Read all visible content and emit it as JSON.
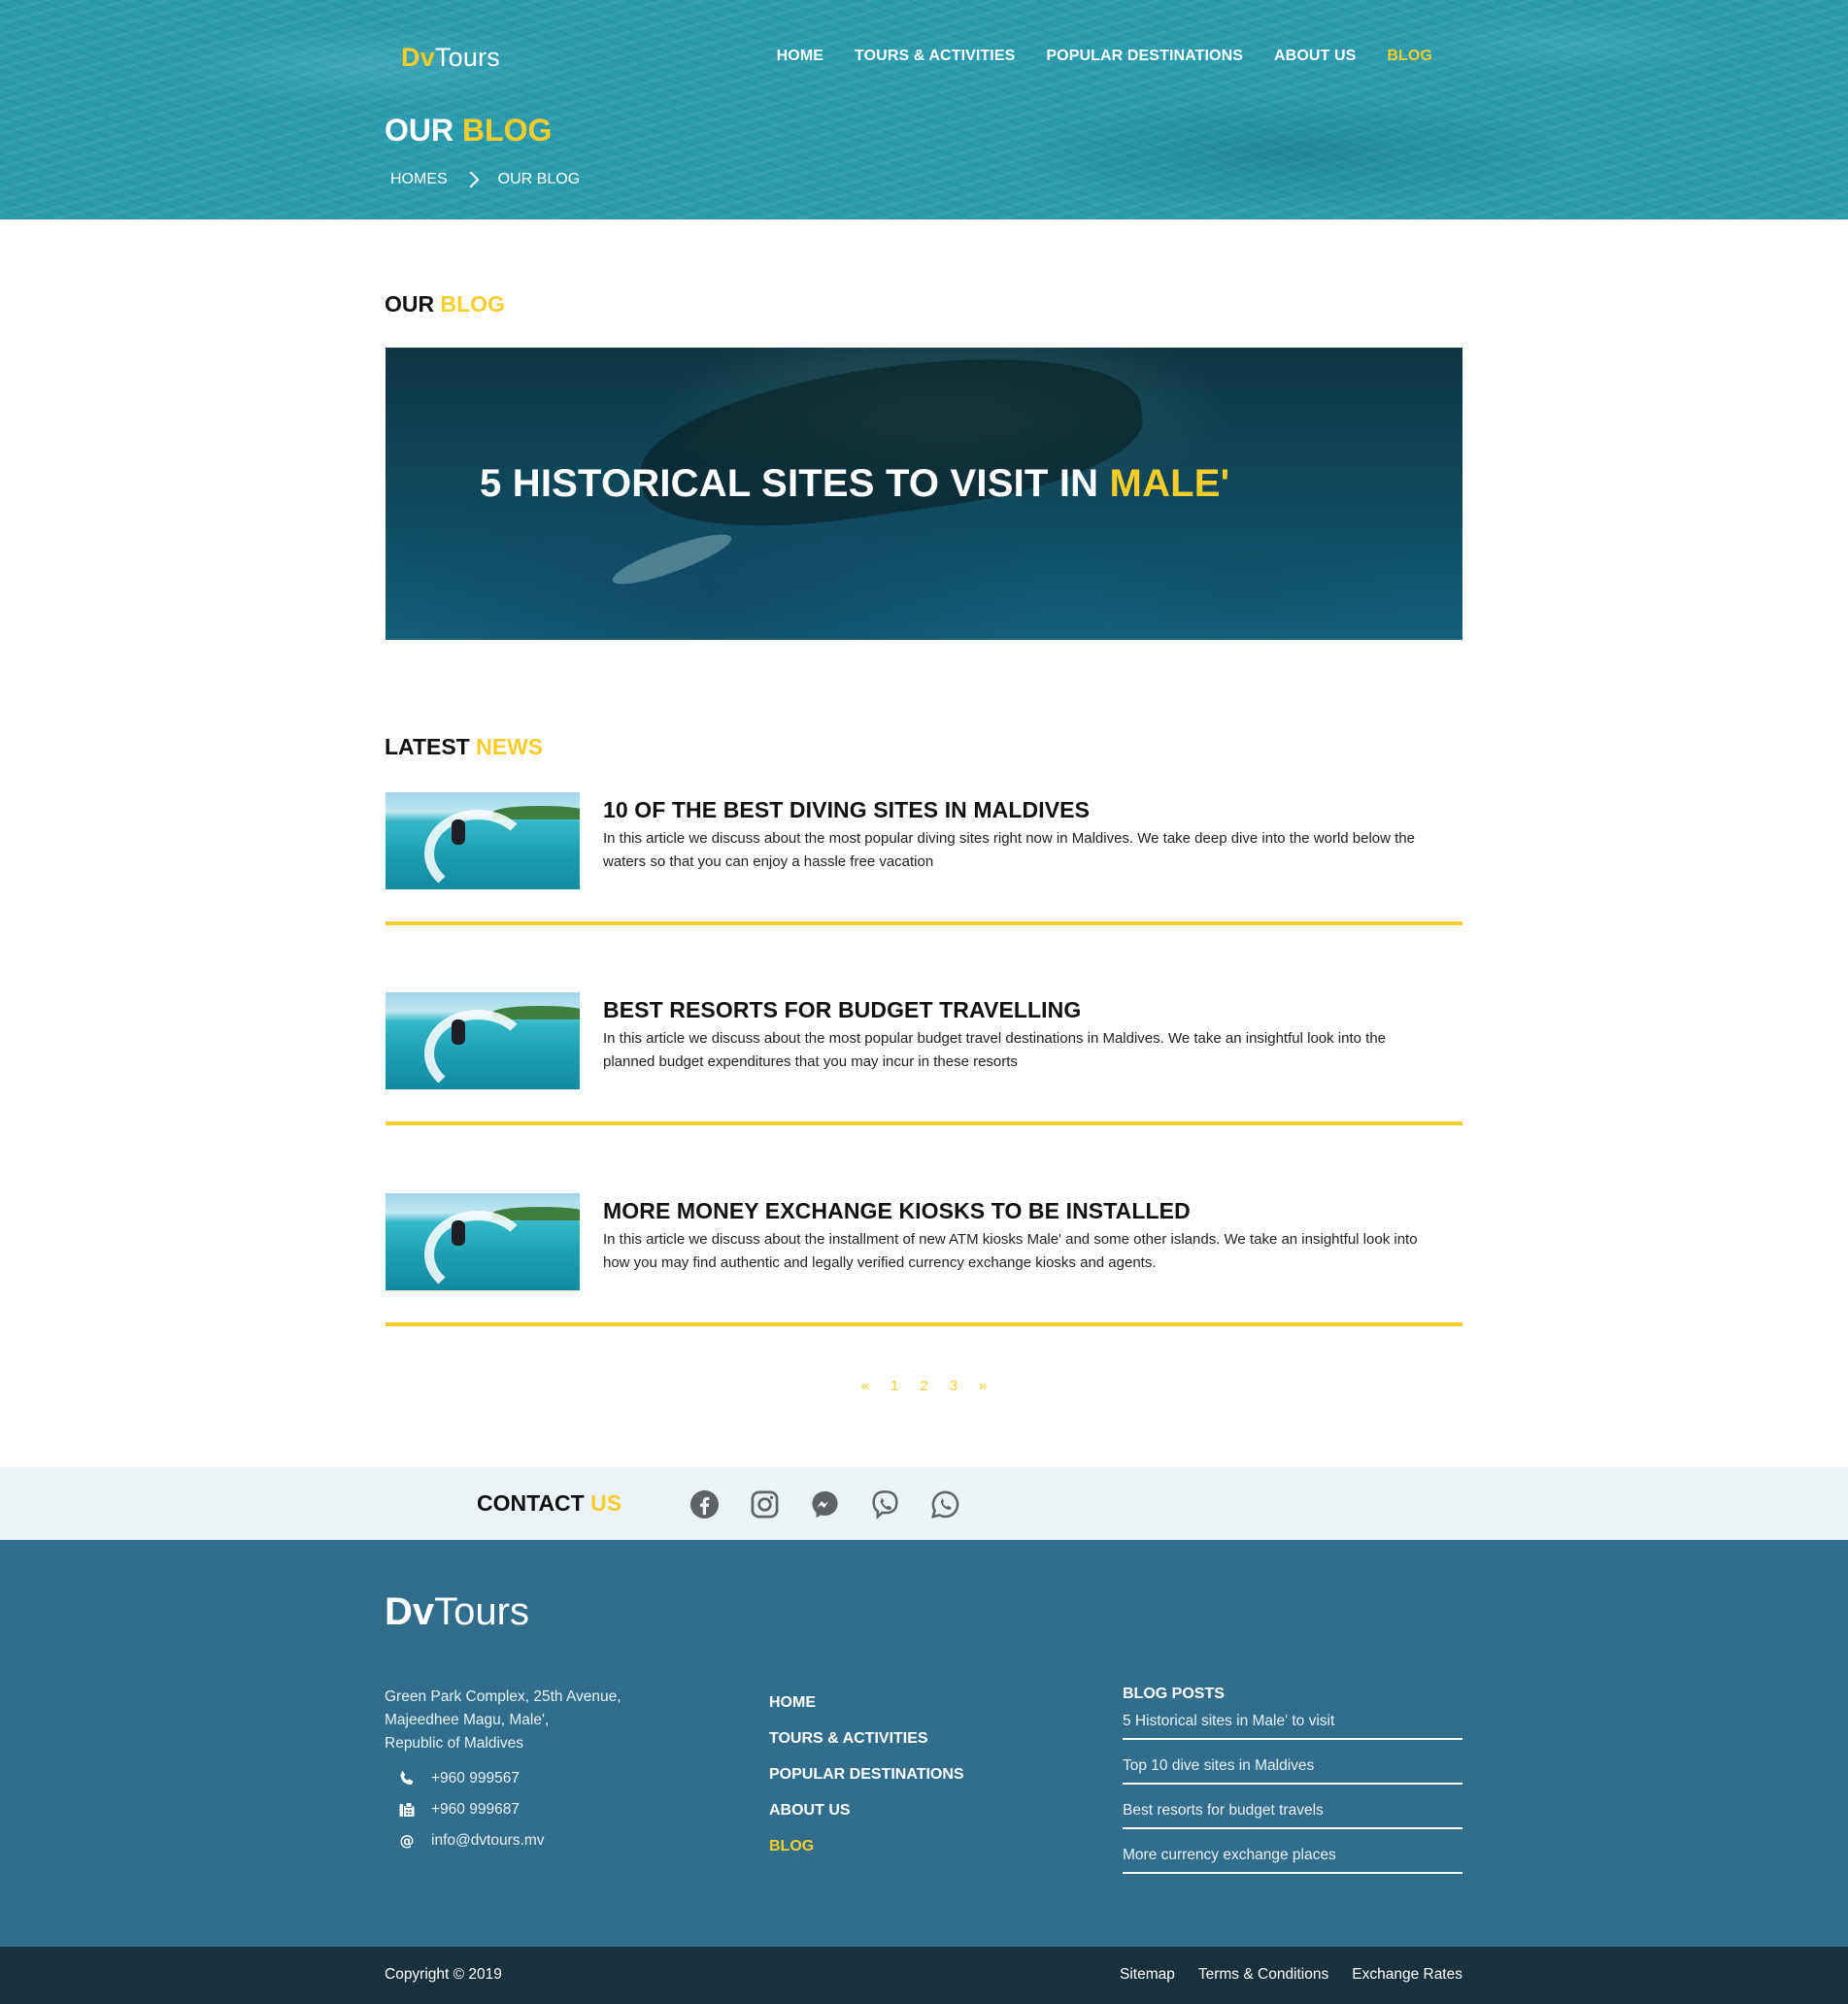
{
  "brand": {
    "first": "Dv",
    "second": "Tours"
  },
  "nav": [
    {
      "label": "HOME",
      "active": false
    },
    {
      "label": "TOURS & ACTIVITIES",
      "active": false
    },
    {
      "label": "POPULAR DESTINATIONS",
      "active": false
    },
    {
      "label": "ABOUT US",
      "active": false
    },
    {
      "label": "BLOG",
      "active": true
    }
  ],
  "hero": {
    "title_a": "OUR ",
    "title_b": "BLOG"
  },
  "breadcrumb": {
    "home": "HOMES",
    "current": "OUR BLOG"
  },
  "blog_section": {
    "title_a": "OUR ",
    "title_b": "BLOG"
  },
  "featured": {
    "title_a": "5 HISTORICAL SITES TO VISIT IN ",
    "title_b": "MALE'"
  },
  "news_section": {
    "title_a": "LATEST ",
    "title_b": "NEWS"
  },
  "news": [
    {
      "title": "10 OF THE BEST DIVING SITES IN MALDIVES",
      "excerpt": "In this article we discuss about the most popular diving sites right now in Maldives. We take deep dive into the world below the waters so that you can enjoy a hassle free vacation"
    },
    {
      "title": "BEST RESORTS FOR BUDGET TRAVELLING",
      "excerpt": "In this article we discuss about the most popular budget travel destinations in Maldives. We take an insightful look into the planned budget expenditures that you may incur in these resorts"
    },
    {
      "title": "MORE MONEY EXCHANGE KIOSKS TO BE INSTALLED",
      "excerpt": "In this article we discuss about the installment of new ATM kiosks Male' and some other islands. We take an insightful look into how you may find authentic and legally verified currency exchange kiosks and agents."
    }
  ],
  "pagination": {
    "prev": "«",
    "pages": [
      "1",
      "2",
      "3"
    ],
    "next": "»"
  },
  "contact": {
    "title_a": "CONTACT ",
    "title_b": "US",
    "social_icons": [
      "facebook-icon",
      "instagram-icon",
      "messenger-icon",
      "viber-icon",
      "whatsapp-icon"
    ]
  },
  "footer": {
    "address": [
      "Green Park Complex, 25th Avenue,",
      "Majeedhee Magu, Male',",
      "Republic of Maldives"
    ],
    "phone": "+960 999567",
    "fax": "+960 999687",
    "email": "info@dvtours.mv",
    "nav": [
      {
        "label": "HOME",
        "active": false
      },
      {
        "label": "TOURS & ACTIVITIES",
        "active": false
      },
      {
        "label": "POPULAR DESTINATIONS",
        "active": false
      },
      {
        "label": "ABOUT US",
        "active": false
      },
      {
        "label": "BLOG",
        "active": true
      }
    ],
    "blog_title": "BLOG POSTS",
    "blog_posts": [
      "5 Historical sites in Male' to visit",
      "Top 10 dive sites in Maldives",
      "Best resorts for budget travels",
      "More currency exchange places"
    ]
  },
  "bottom": {
    "copyright": "Copyright © 2019",
    "links": [
      "Sitemap",
      "Terms & Conditions",
      "Exchange Rates"
    ]
  },
  "colors": {
    "accent": "#f7cd2c",
    "hero": "#2a9cae",
    "footer": "#316e8b",
    "bottom_bar": "#17313f",
    "contact_bar": "#ebf3f5",
    "icon_gray": "#5f6368"
  }
}
